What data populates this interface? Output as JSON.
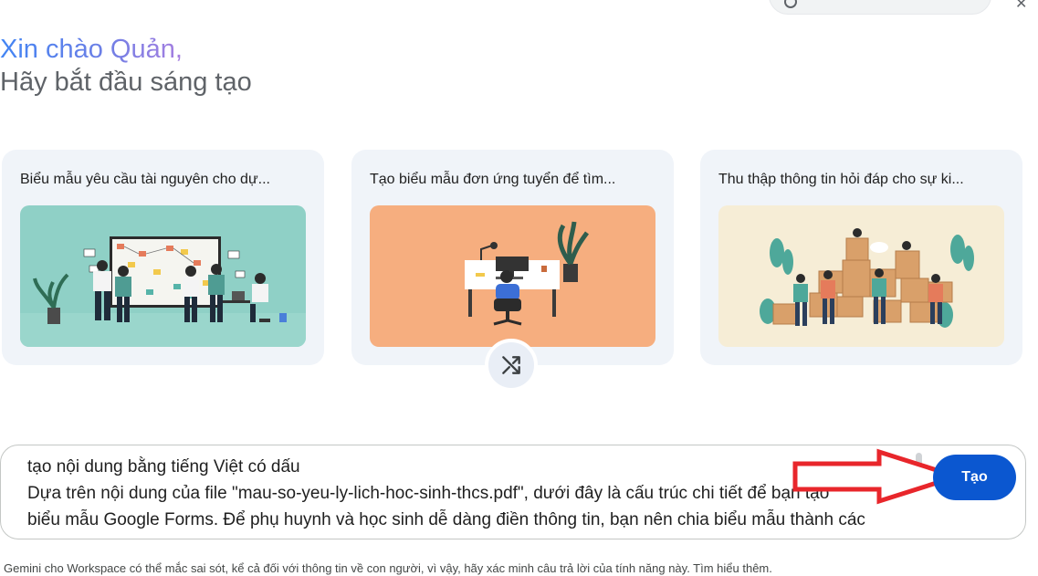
{
  "greeting": {
    "hello": "Xin chào Quản,",
    "subtitle": "Hãy bắt đầu sáng tạo"
  },
  "cards": [
    {
      "title": "Biểu mẫu yêu cầu tài nguyên cho dự...",
      "image": "office-whiteboard-illustration"
    },
    {
      "title": "Tạo biểu mẫu đơn ứng tuyển để tìm...",
      "image": "desk-workspace-illustration"
    },
    {
      "title": "Thu thập thông tin hỏi đáp cho sự ki...",
      "image": "warehouse-boxes-illustration"
    }
  ],
  "shuffle": {
    "icon": "shuffle-icon"
  },
  "prompt": {
    "lines": [
      "tạo nội dung bằng tiếng Việt có dấu",
      "Dựa trên nội dung của file \"mau-so-yeu-ly-lich-hoc-sinh-thcs.pdf\", dưới đây là cấu trúc chi tiết để bạn tạo",
      "biểu mẫu Google Forms. Để phụ huynh và học sinh dễ dàng điền thông tin, bạn nên chia biểu mẫu thành các"
    ]
  },
  "create_button": {
    "label": "Tạo"
  },
  "disclaimer": "Gemini cho Workspace có thể mắc sai sót, kể cả đối với thông tin về con người, vì vậy, hãy xác minh câu trả lời của tính năng này. Tìm hiểu thêm.",
  "colors": {
    "accent": "#0b57d0",
    "card_bg": "#f0f4f9",
    "arrow": "#e8262b"
  }
}
